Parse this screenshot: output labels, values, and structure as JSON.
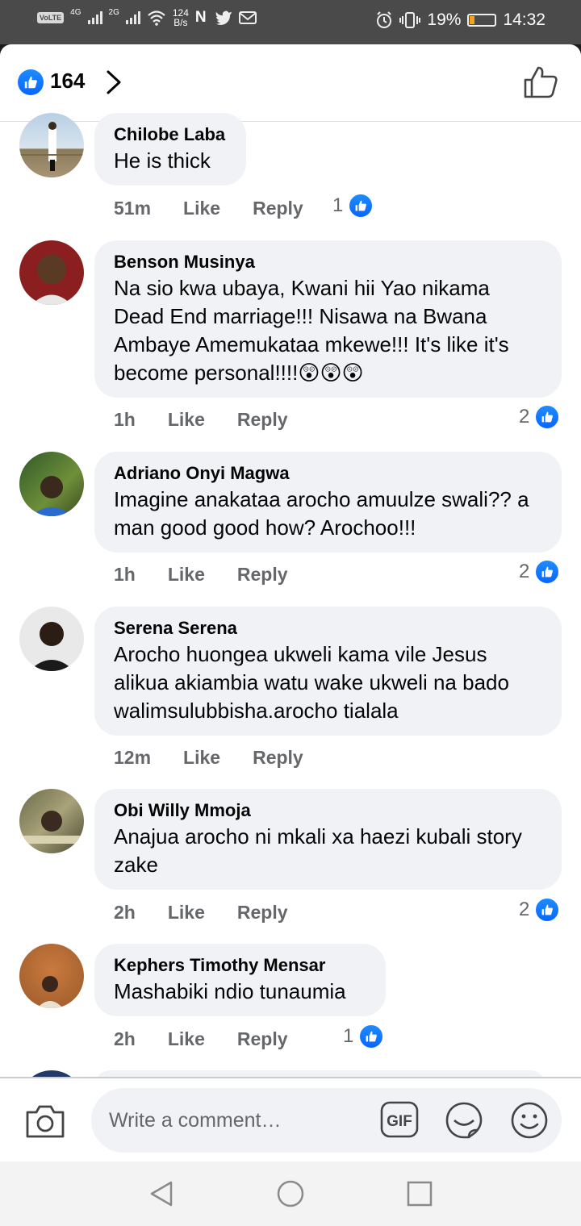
{
  "status_bar": {
    "volte": "VoLTE",
    "net1": "4G",
    "net2": "2G",
    "speed_value": "124",
    "speed_unit": "B/s",
    "apps": "N",
    "battery": "19%",
    "time": "14:32",
    "battery_level_percent": 19
  },
  "reactions": {
    "count": "164"
  },
  "comments": [
    {
      "author": "Chilobe Laba",
      "text": "He is thick",
      "time": "51m",
      "like_label": "Like",
      "reply_label": "Reply",
      "likes": "1"
    },
    {
      "author": "Benson Musinya",
      "text": "Na sio kwa ubaya, Kwani hii Yao nikama Dead End marriage!!! Nisawa na Bwana Ambaye Amemukataa mkewe!!! It's like it's become personal!!!!😲😲😲",
      "time": "1h",
      "like_label": "Like",
      "reply_label": "Reply",
      "likes": "2"
    },
    {
      "author": "Adriano Onyi Magwa",
      "text": "Imagine anakataa arocho amuulze swali?? a man good good how? Arochoo!!!",
      "time": "1h",
      "like_label": "Like",
      "reply_label": "Reply",
      "likes": "2"
    },
    {
      "author": "Serena Serena",
      "text": "Arocho huongea ukweli kama vile Jesus alikua akiambia watu wake ukweli na bado walimsulubbisha.arocho tialala",
      "time": "12m",
      "like_label": "Like",
      "reply_label": "Reply",
      "likes": ""
    },
    {
      "author": "Obi Willy Mmoja",
      "text": "Anajua arocho ni mkali xa haezi kubali story zake",
      "time": "2h",
      "like_label": "Like",
      "reply_label": "Reply",
      "likes": "2"
    },
    {
      "author": "Kephers Timothy Mensar",
      "text": "Mashabiki ndio tunaumia",
      "time": "2h",
      "like_label": "Like",
      "reply_label": "Reply",
      "likes": "1"
    }
  ],
  "composer": {
    "placeholder": "Write a comment…",
    "gif_label": "GIF"
  },
  "colors": {
    "brand_blue": "#1877f2",
    "bubble_bg": "#f0f2f5",
    "meta_gray": "#65676b"
  }
}
